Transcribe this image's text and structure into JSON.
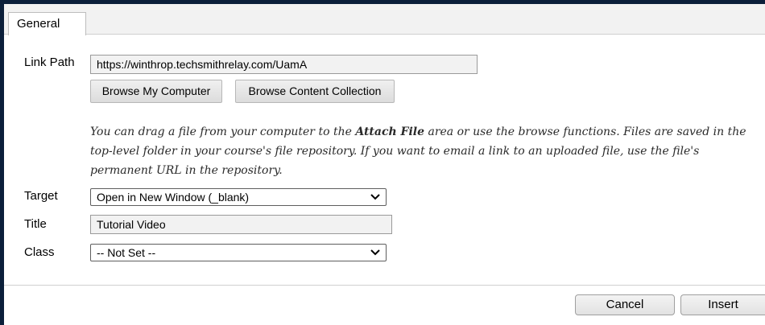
{
  "tabs": {
    "general": "General"
  },
  "form": {
    "link_path": {
      "label": "Link Path",
      "value": "https://winthrop.techsmithrelay.com/UamA",
      "browse_computer": "Browse My Computer",
      "browse_content": "Browse Content Collection"
    },
    "help": {
      "part1": "You can drag a file from your computer to the ",
      "emphasis": "Attach File",
      "part2": " area or use the browse functions. Files are saved in the top-level folder in your course's file repository. If you want to email a link to an uploaded file, use the file's permanent URL in the repository."
    },
    "target": {
      "label": "Target",
      "value": "Open in New Window (_blank)"
    },
    "title": {
      "label": "Title",
      "value": "Tutorial Video"
    },
    "class": {
      "label": "Class",
      "value": "-- Not Set --"
    }
  },
  "footer": {
    "cancel": "Cancel",
    "insert": "Insert"
  },
  "colors": {
    "frame_border": "#0b1f3a",
    "button_bg": "#dcdcdc"
  }
}
